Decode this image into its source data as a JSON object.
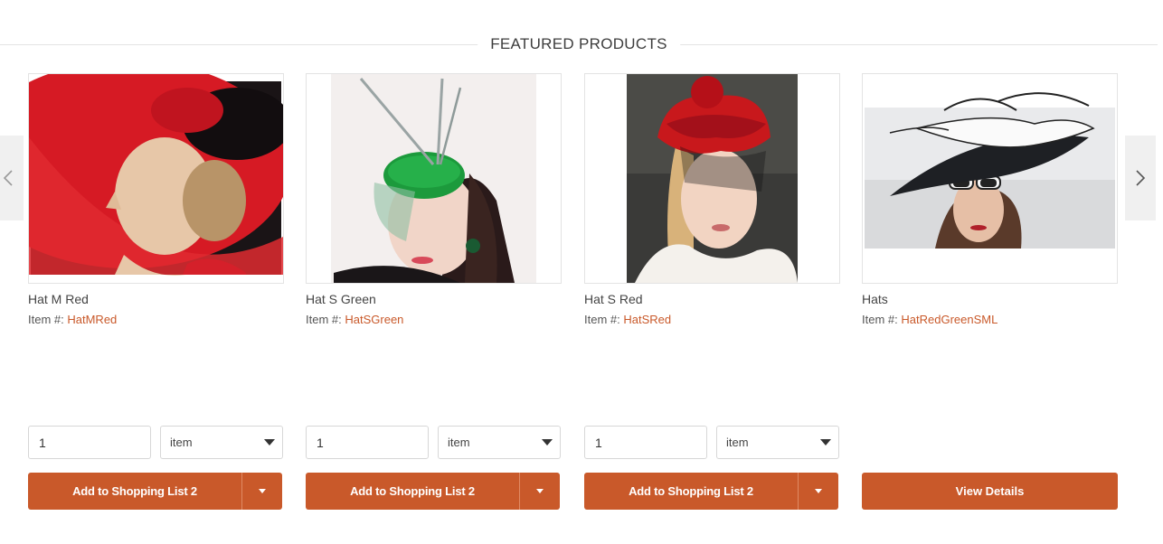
{
  "section": {
    "title": "FEATURED PRODUCTS"
  },
  "carousel": {
    "prev_icon": "chevron-left-icon",
    "next_icon": "chevron-right-icon"
  },
  "products": [
    {
      "name": "Hat M Red",
      "item_label": "Item #:",
      "item_code": "HatMRed",
      "qty": "1",
      "uom": "item",
      "button_label": "Add to Shopping List 2",
      "image": "red-wide-brim-hat-photo"
    },
    {
      "name": "Hat S Green",
      "item_label": "Item #:",
      "item_code": "HatSGreen",
      "qty": "1",
      "uom": "item",
      "button_label": "Add to Shopping List 2",
      "image": "green-fascinator-photo"
    },
    {
      "name": "Hat S Red",
      "item_label": "Item #:",
      "item_code": "HatSRed",
      "qty": "1",
      "uom": "item",
      "button_label": "Add to Shopping List 2",
      "image": "red-ruffle-hat-photo"
    },
    {
      "name": "Hats",
      "item_label": "Item #:",
      "item_code": "HatRedGreenSML",
      "button_label": "View Details",
      "image": "black-white-brim-hat-photo"
    }
  ],
  "colors": {
    "accent": "#c9592a",
    "border": "#e3e3e3",
    "arrow_bg": "#f0f0f0"
  }
}
